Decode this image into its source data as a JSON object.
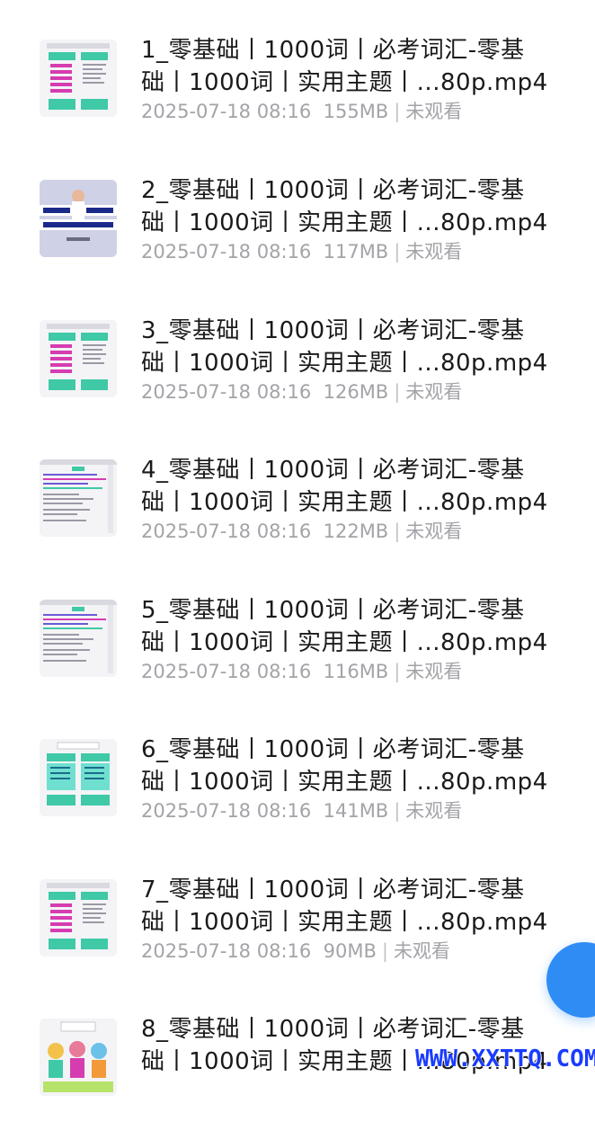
{
  "items": [
    {
      "line1": "1_零基础丨1000词丨必考词汇-零基",
      "line2": "础丨1000词丨实用主题丨...80p.mp4",
      "date": "2025-07-18 08:16",
      "size": "155MB",
      "status": "未观看",
      "thumb": "chart-green-pink"
    },
    {
      "line1": "2_零基础丨1000词丨必考词汇-零基",
      "line2": "础丨1000词丨实用主题丨...80p.mp4",
      "date": "2025-07-18 08:16",
      "size": "117MB",
      "status": "未观看",
      "thumb": "teacher-banner"
    },
    {
      "line1": "3_零基础丨1000词丨必考词汇-零基",
      "line2": "础丨1000词丨实用主题丨...80p.mp4",
      "date": "2025-07-18 08:16",
      "size": "126MB",
      "status": "未观看",
      "thumb": "chart-green-pink"
    },
    {
      "line1": "4_零基础丨1000词丨必考词汇-零基",
      "line2": "础丨1000词丨实用主题丨...80p.mp4",
      "date": "2025-07-18 08:16",
      "size": "122MB",
      "status": "未观看",
      "thumb": "text-slide"
    },
    {
      "line1": "5_零基础丨1000词丨必考词汇-零基",
      "line2": "础丨1000词丨实用主题丨...80p.mp4",
      "date": "2025-07-18 08:16",
      "size": "116MB",
      "status": "未观看",
      "thumb": "text-slide"
    },
    {
      "line1": "6_零基础丨1000词丨必考词汇-零基",
      "line2": "础丨1000词丨实用主题丨...80p.mp4",
      "date": "2025-07-18 08:16",
      "size": "141MB",
      "status": "未观看",
      "thumb": "chart-teal"
    },
    {
      "line1": "7_零基础丨1000词丨必考词汇-零基",
      "line2": "础丨1000词丨实用主题丨...80p.mp4",
      "date": "2025-07-18 08:16",
      "size": "90MB",
      "status": "未观看",
      "thumb": "chart-green-pink"
    },
    {
      "line1": "8_零基础丨1000词丨必考词汇-零基",
      "line2": "础丨1000词丨实用主题丨...80p.mp4",
      "date": "",
      "size": "",
      "status": "",
      "thumb": "cartoon-job"
    }
  ],
  "watermark": "WWW.XXTTQ.COM",
  "colors": {
    "accent": "#2f8cf5",
    "meta": "#a3a3a8",
    "title": "#1a1a1a",
    "watermark": "#1a3cff"
  }
}
